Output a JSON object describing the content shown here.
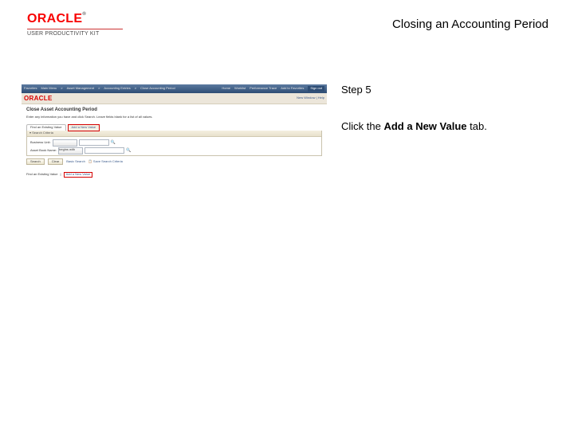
{
  "brand": {
    "logo": "ORACLE",
    "subline": "USER PRODUCTIVITY KIT"
  },
  "title": "Closing an Accounting Period",
  "panel": {
    "step": "Step 5",
    "instr_pre": "Click the ",
    "instr_bold": "Add a New Value",
    "instr_post": " tab."
  },
  "shot": {
    "nav": {
      "items": [
        "Favorites",
        "Main Menu",
        "Asset Management",
        "Accounting Entries",
        "Close Accounting Period"
      ],
      "right": [
        "Home",
        "Worklist",
        "Performance Trace",
        "Add to Favorites",
        "Sign out"
      ]
    },
    "oraclebar": {
      "logo": "ORACLE",
      "window_label": "New Window | Help"
    },
    "page_title": "Close Asset Accounting Period",
    "blurb": "Enter any information you have and click Search. Leave fields blank for a list of all values.",
    "tabs": {
      "find": "Find an Existing Value",
      "add": "Add a New Value"
    },
    "section_head": "Search Criteria",
    "fields": {
      "bu_label": "Business Unit:",
      "bu_op": "= ",
      "bu_val": "",
      "book_label": "Asset Book Name:",
      "book_op": "begins with",
      "book_val": ""
    },
    "buttons": {
      "search": "Search",
      "clear": "Clear",
      "basic": "Basic Search",
      "save": "Save Search Criteria"
    },
    "footer": {
      "label": "Find an Existing Value",
      "add": "Add a New Value"
    }
  }
}
